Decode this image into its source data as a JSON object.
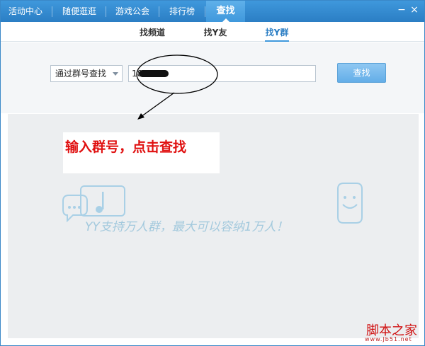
{
  "nav": {
    "items": [
      {
        "label": "活动中心"
      },
      {
        "label": "随便逛逛"
      },
      {
        "label": "游戏公会"
      },
      {
        "label": "排行榜"
      },
      {
        "label": "查找"
      }
    ],
    "active": "查找",
    "min_glyph": "−",
    "close_glyph": "×"
  },
  "subtabs": {
    "items": [
      {
        "label": "找频道"
      },
      {
        "label": "找Y友"
      },
      {
        "label": "找Y群"
      }
    ],
    "active": "找Y群"
  },
  "search": {
    "mode_value": "通过群号查找",
    "input_value": "18",
    "button_label": "查找"
  },
  "annotation": {
    "note": "输入群号，点击查找"
  },
  "banner": {
    "text": "YY支持万人群，最大可以容纳1万人！"
  },
  "watermark": {
    "name": "脚本之家",
    "url": "www.Jb51.net"
  },
  "colors": {
    "nav_bg": "#2b7ec4",
    "accent": "#3f98dc",
    "note_red": "#e01010",
    "banner_blue": "#9cc6dc"
  }
}
